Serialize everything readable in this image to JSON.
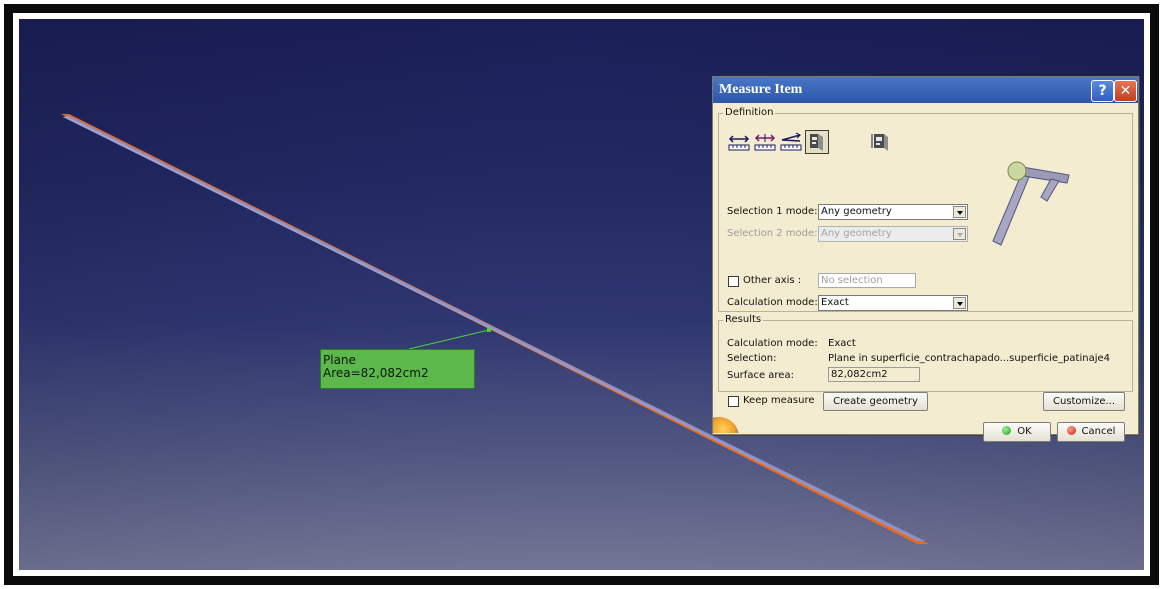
{
  "annotation": {
    "line1": "Plane",
    "line2": "Area=82,082cm2"
  },
  "dialog": {
    "title": "Measure Item",
    "help_glyph": "?",
    "close_glyph": "✕",
    "definition": {
      "legend": "Definition",
      "selection1_label": "Selection 1 mode:",
      "selection1_value": "Any geometry",
      "selection2_label": "Selection 2 mode:",
      "selection2_value": "Any geometry",
      "other_axis_label": "Other axis :",
      "other_axis_value": "No selection",
      "calc_mode_label": "Calculation mode:",
      "calc_mode_value": "Exact"
    },
    "results": {
      "legend": "Results",
      "calc_mode_label": "Calculation mode:",
      "calc_mode_value": "Exact",
      "selection_label": "Selection:",
      "selection_value": "Plane in superficie_contrachapado...superficie_patinaje4",
      "surface_area_label": "Surface area:",
      "surface_area_value": "82,082cm2"
    },
    "keep_measure_label": "Keep measure",
    "create_geometry_label": "Create geometry",
    "customize_label": "Customize...",
    "ok_label": "OK",
    "cancel_label": "Cancel"
  },
  "colors": {
    "plane_edge": "#e06b2b",
    "plane_face": "#8d90c6",
    "annotation_bg": "#5cb84a",
    "titlebar": "#2c57a8"
  }
}
